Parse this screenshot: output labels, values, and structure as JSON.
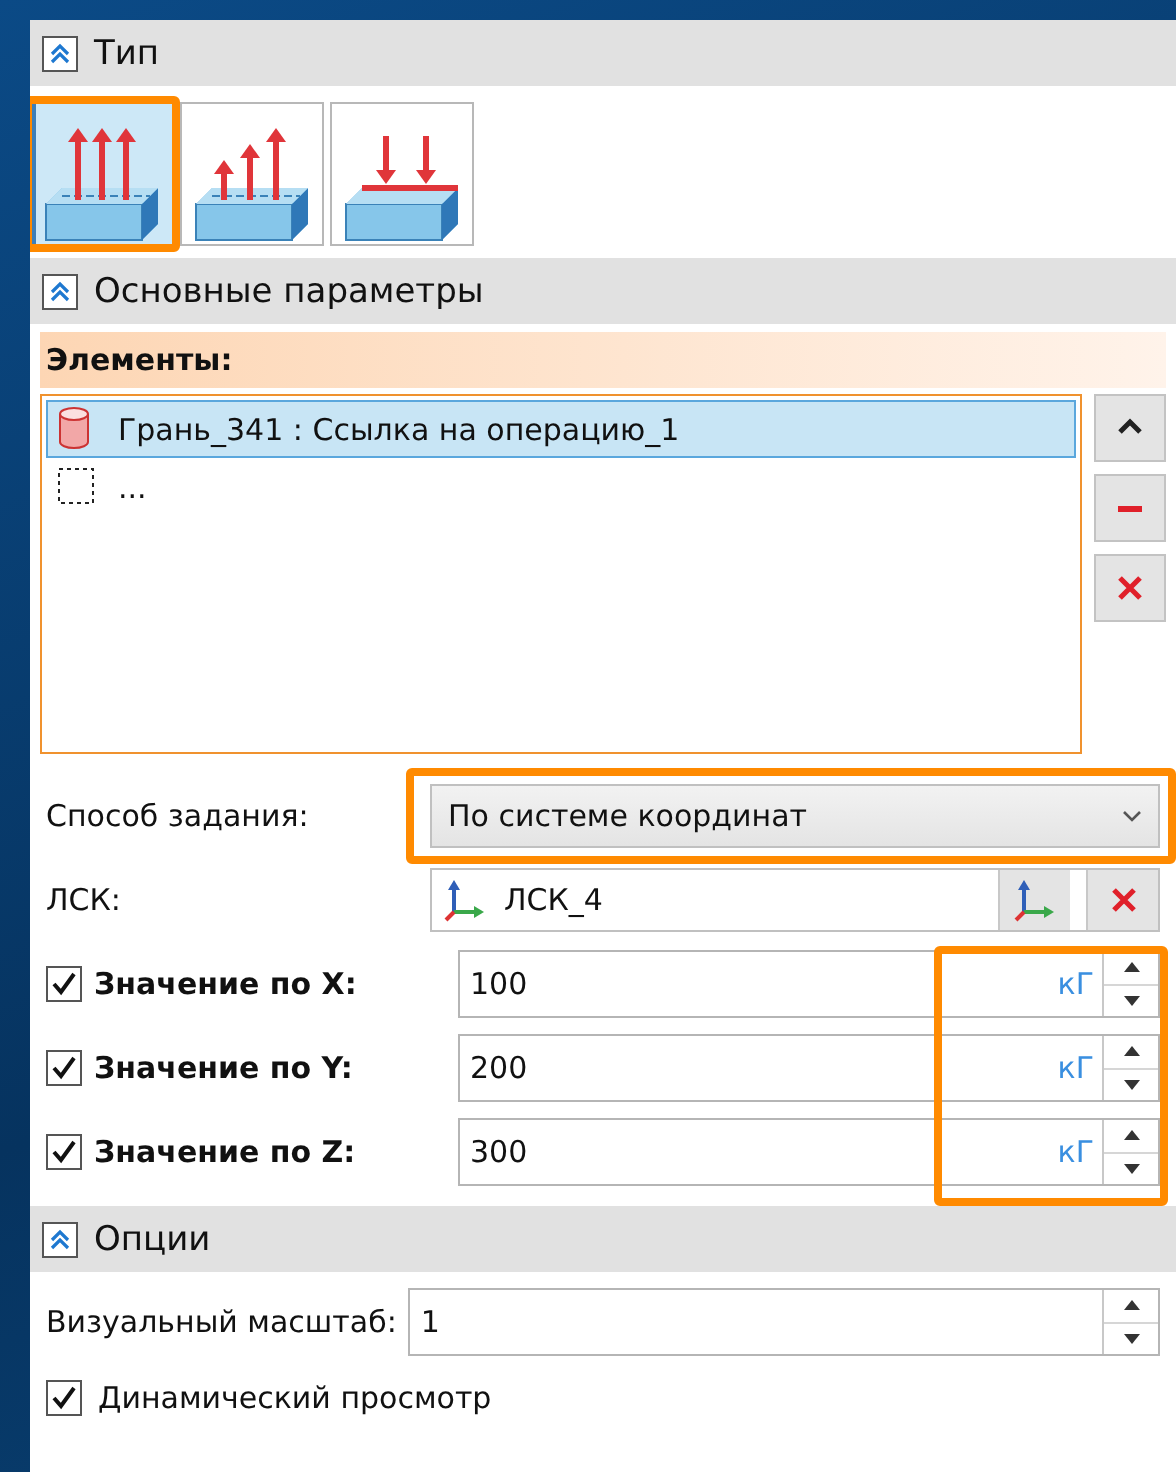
{
  "sections": [
    {
      "title": "Тип",
      "expanded": true
    },
    {
      "title": "Основные параметры",
      "expanded": true
    },
    {
      "title": "Опции",
      "expanded": true
    }
  ],
  "type_options": [
    {
      "kind": "uniform",
      "selected": true,
      "highlighted": true
    },
    {
      "kind": "rising",
      "selected": false,
      "highlighted": false
    },
    {
      "kind": "pressing",
      "selected": false,
      "highlighted": false
    }
  ],
  "elements": {
    "title": "Элементы:",
    "items": [
      {
        "kind": "face",
        "label": "Грань_341 : Ссылка на операцию_1",
        "selected": true
      },
      {
        "kind": "empty",
        "label": "...",
        "selected": false
      }
    ]
  },
  "method": {
    "label": "Способ задания:",
    "value": "По системе координат",
    "highlighted": true
  },
  "lcs": {
    "label": "ЛСК:",
    "value": "ЛСК_4"
  },
  "values": {
    "units_highlighted": true,
    "rows": [
      {
        "label": "Значение по X:",
        "value": "100",
        "unit": "кГ",
        "checked": true
      },
      {
        "label": "Значение по Y:",
        "value": "200",
        "unit": "кГ",
        "checked": true
      },
      {
        "label": "Значение по Z:",
        "value": "300",
        "unit": "кГ",
        "checked": true
      }
    ]
  },
  "scale": {
    "label": "Визуальный масштаб:",
    "value": "1"
  },
  "dynamic_preview": {
    "label": "Динамический просмотр",
    "checked": true
  }
}
